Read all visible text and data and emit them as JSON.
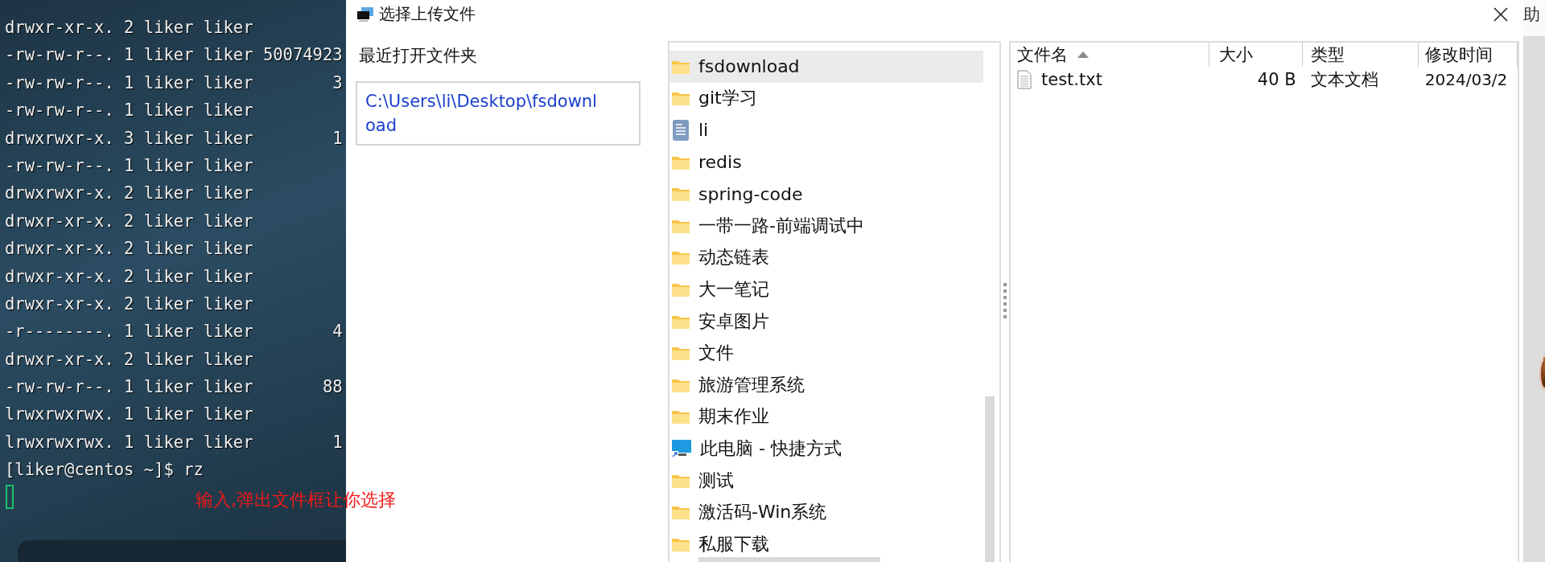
{
  "terminal": {
    "lines": [
      "drwxr-xr-x. 2 liker liker",
      "-rw-rw-r--. 1 liker liker 50074923",
      "-rw-rw-r--. 1 liker liker        3",
      "-rw-rw-r--. 1 liker liker",
      "drwxrwxr-x. 3 liker liker        1",
      "-rw-rw-r--. 1 liker liker",
      "drwxrwxr-x. 2 liker liker",
      "drwxr-xr-x. 2 liker liker",
      "drwxr-xr-x. 2 liker liker",
      "drwxr-xr-x. 2 liker liker",
      "drwxr-xr-x. 2 liker liker",
      "-r--------. 1 liker liker        4",
      "drwxr-xr-x. 2 liker liker",
      "-rw-rw-r--. 1 liker liker       88",
      "lrwxrwxrwx. 1 liker liker",
      "lrwxrwxrwx. 1 liker liker        1",
      "[liker@centos ~]$ rz"
    ],
    "annotation": "输入,弹出文件框让你选择"
  },
  "dialog": {
    "title": "选择上传文件",
    "recent_label": "最近打开文件夹",
    "recent_path": "C:\\Users\\li\\Desktop\\fsdownload",
    "folders": [
      {
        "name": "fsdownload",
        "kind": "folder",
        "selected": true
      },
      {
        "name": "git学习",
        "kind": "folder",
        "selected": false
      },
      {
        "name": "li",
        "kind": "document",
        "selected": false
      },
      {
        "name": "redis",
        "kind": "folder",
        "selected": false
      },
      {
        "name": "spring-code",
        "kind": "folder",
        "selected": false
      },
      {
        "name": "一带一路-前端调试中",
        "kind": "folder",
        "selected": false
      },
      {
        "name": "动态链表",
        "kind": "folder",
        "selected": false
      },
      {
        "name": "大一笔记",
        "kind": "folder",
        "selected": false
      },
      {
        "name": "安卓图片",
        "kind": "folder",
        "selected": false
      },
      {
        "name": "文件",
        "kind": "folder",
        "selected": false
      },
      {
        "name": "旅游管理系统",
        "kind": "folder",
        "selected": false
      },
      {
        "name": "期末作业",
        "kind": "folder",
        "selected": false
      },
      {
        "name": "此电脑 - 快捷方式",
        "kind": "computer",
        "selected": false
      },
      {
        "name": "测试",
        "kind": "folder",
        "selected": false
      },
      {
        "name": "激活码-Win系统",
        "kind": "folder",
        "selected": false
      },
      {
        "name": "私服下载",
        "kind": "folder",
        "selected": false
      }
    ],
    "columns": [
      "文件名",
      "大小",
      "类型",
      "修改时间"
    ],
    "files": [
      {
        "name": "test.txt",
        "size": "40 B",
        "type": "文本文档",
        "modified": "2024/03/2"
      }
    ]
  },
  "background_window": {
    "title": "助"
  }
}
